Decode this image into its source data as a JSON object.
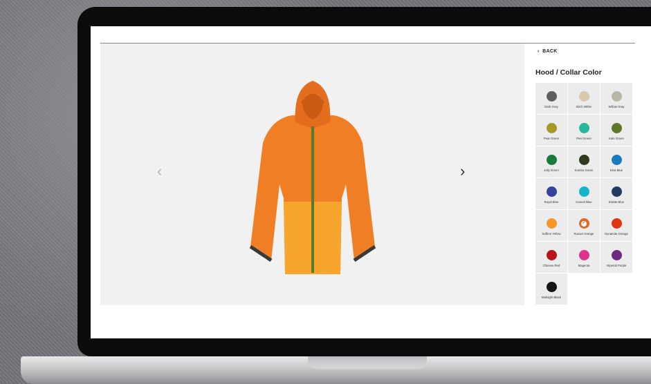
{
  "panel": {
    "back_label": "BACK",
    "title": "Hood / Collar Color"
  },
  "viewer": {
    "image_count": 7,
    "active_index": 0
  },
  "colors": {
    "accent": "#d25a1a",
    "panel_bg": "#ececec",
    "viewer_bg": "#f1f1f1"
  },
  "swatches": [
    {
      "name": "Dark Gray",
      "hex": "#5f5f5f"
    },
    {
      "name": "Birch White",
      "hex": "#d9c9ad"
    },
    {
      "name": "Willow Gray",
      "hex": "#b9b8a8"
    },
    {
      "name": "Pear Green",
      "hex": "#a59a23"
    },
    {
      "name": "Peel Green",
      "hex": "#27b79b"
    },
    {
      "name": "Kale Green",
      "hex": "#5c7a26"
    },
    {
      "name": "Jolly Green",
      "hex": "#177a3a"
    },
    {
      "name": "Kombu Green",
      "hex": "#2f3a1f"
    },
    {
      "name": "Diva Blue",
      "hex": "#1c7bc0"
    },
    {
      "name": "Royal Blue",
      "hex": "#35449a"
    },
    {
      "name": "Caneel Blue",
      "hex": "#17b3c6"
    },
    {
      "name": "Estate Blue",
      "hex": "#233a63"
    },
    {
      "name": "Saffron Yellow",
      "hex": "#f7962a"
    },
    {
      "name": "Russet Orange",
      "hex": "#df6a22",
      "selected": true
    },
    {
      "name": "Dynamite Orange",
      "hex": "#e03512"
    },
    {
      "name": "Chinese Red",
      "hex": "#b9141c"
    },
    {
      "name": "Magenta",
      "hex": "#e0338f"
    },
    {
      "name": "Imperial Purple",
      "hex": "#6b2a84"
    },
    {
      "name": "Midnight Black",
      "hex": "#141414"
    }
  ]
}
